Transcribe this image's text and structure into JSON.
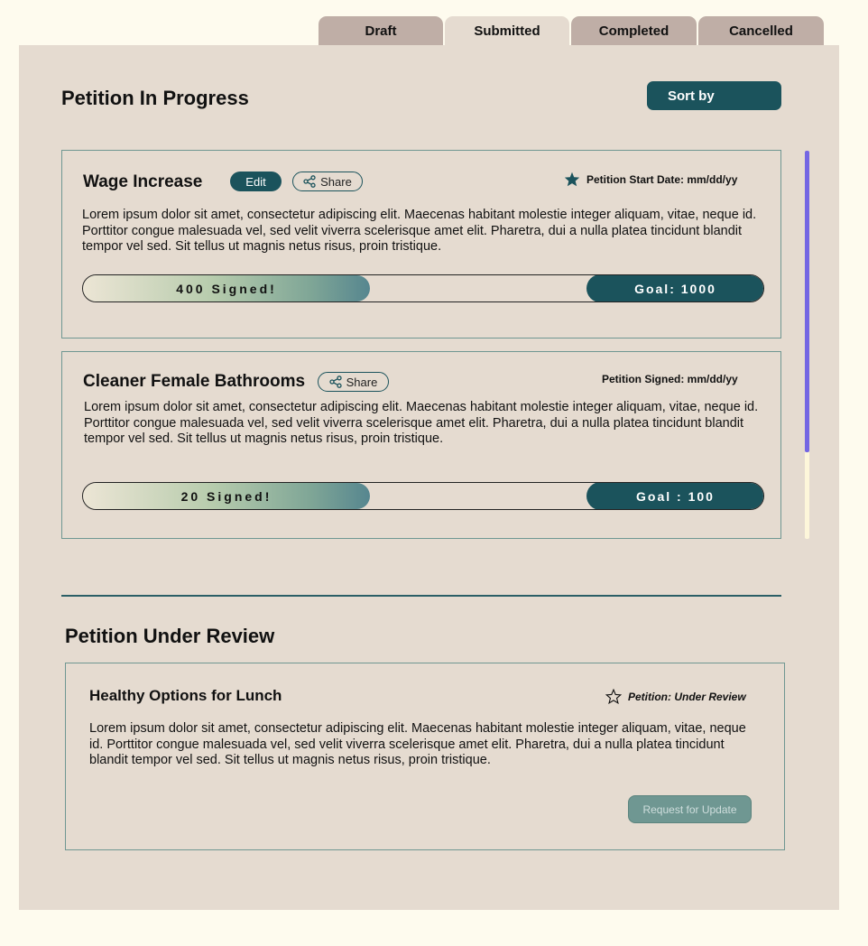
{
  "tabs": [
    {
      "label": "Draft",
      "active": false
    },
    {
      "label": "Submitted",
      "active": true
    },
    {
      "label": "Completed",
      "active": false
    },
    {
      "label": "Cancelled",
      "active": false
    }
  ],
  "in_progress": {
    "title": "Petition In Progress",
    "sort_label": "Sort by",
    "petitions": [
      {
        "title": "Wage Increase",
        "edit_label": "Edit",
        "share_label": "Share",
        "meta_label": "Petition Start Date: mm/dd/yy",
        "meta_icon": "star-filled-icon",
        "body": "Lorem ipsum dolor sit amet, consectetur adipiscing elit. Maecenas habitant molestie integer aliquam, vitae, neque id. Porttitor congue malesuada vel, sed velit viverra scelerisque amet elit. Pharetra, dui a nulla platea tincidunt blandit tempor vel sed. Sit tellus ut magnis netus risus, proin tristique.",
        "signed_label": "400 Signed!",
        "goal_label": "Goal: 1000",
        "signed": 400,
        "goal": 1000
      },
      {
        "title": "Cleaner Female Bathrooms",
        "share_label": "Share",
        "meta_label": "Petition Signed:  mm/dd/yy",
        "body": "Lorem ipsum dolor sit amet, consectetur adipiscing elit. Maecenas habitant molestie integer aliquam, vitae, neque id. Porttitor congue malesuada vel, sed velit viverra scelerisque amet elit. Pharetra, dui a nulla platea tincidunt blandit tempor vel sed. Sit tellus ut magnis netus risus, proin tristique.",
        "signed_label": "20 Signed!",
        "goal_label": "Goal : 100",
        "signed": 20,
        "goal": 100
      }
    ]
  },
  "under_review": {
    "title": "Petition Under Review",
    "petition": {
      "title": "Healthy Options for Lunch",
      "meta_label": "Petition: Under Review",
      "meta_icon": "star-outline-icon",
      "body": "Lorem ipsum dolor sit amet, consectetur adipiscing elit. Maecenas habitant molestie integer aliquam, vitae, neque id. Porttitor congue malesuada vel, sed velit viverra scelerisque amet elit. Pharetra, dui a nulla platea tincidunt blandit tempor vel sed. Sit tellus ut magnis netus risus, proin tristique.",
      "request_label": "Request for Update"
    }
  },
  "colors": {
    "page_bg": "#fefbee",
    "panel_bg": "#e5dbd0",
    "tab_inactive": "#bfaea6",
    "accent": "#1b535c",
    "scroll_thumb": "#7466e3"
  }
}
